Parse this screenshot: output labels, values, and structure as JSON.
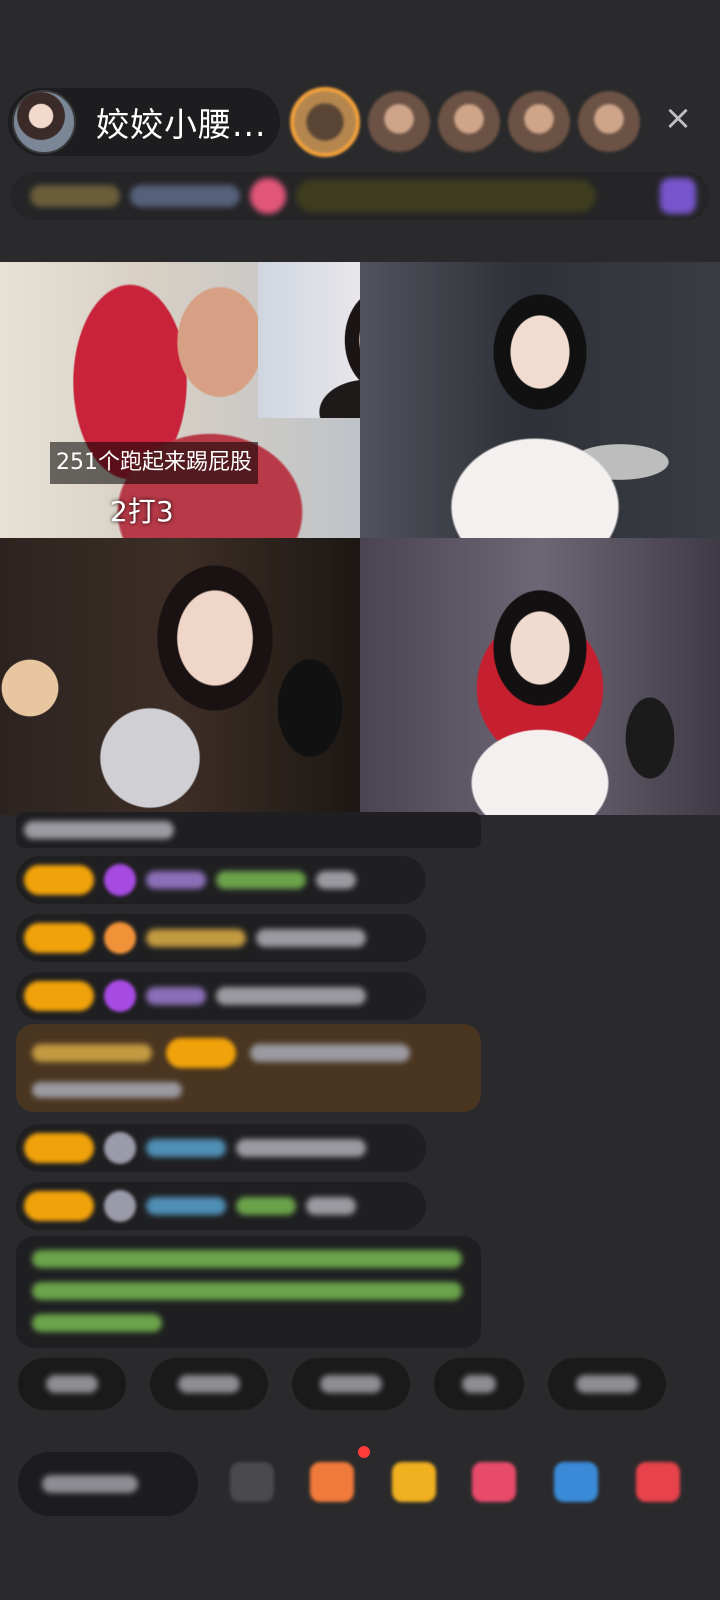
{
  "host": {
    "name": "姣姣小腰..."
  },
  "header": {
    "close_symbol": "×",
    "viewer_count": 5
  },
  "video": {
    "overlay_caption": "251个跑起来踢屁股",
    "overlay_score": "2打3"
  },
  "colors": {
    "background": "#2a2a2c",
    "level_badge": "#f0a20a",
    "accent_orange": "#f5a23a",
    "notification": "#ff3b3b"
  },
  "icons": [
    "close-icon",
    "emoji-icon",
    "gift-icon",
    "gift-box-icon",
    "heart-icon",
    "game-icon",
    "more-icon"
  ]
}
